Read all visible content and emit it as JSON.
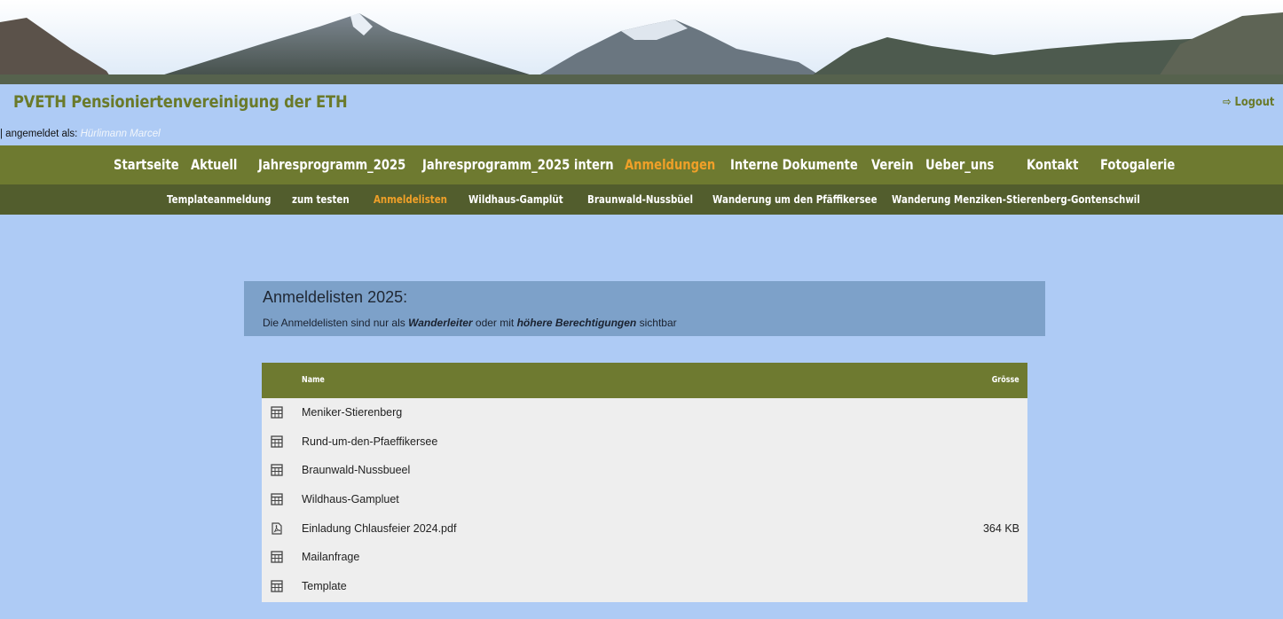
{
  "header": {
    "site_title": "PVETH Pensioniertenvereinigung der ETH",
    "logout_label": "Logout",
    "logged_in_label": "| angemeldet als:",
    "user_name": "Hürlimann Marcel"
  },
  "main_nav": {
    "items": [
      {
        "label": "Startseite",
        "active": false
      },
      {
        "label": "Aktuell",
        "active": false
      },
      {
        "label": "Jahresprogramm_2025",
        "active": false
      },
      {
        "label": "Jahresprogramm_2025 intern",
        "active": false
      },
      {
        "label": "Anmeldungen",
        "active": true
      },
      {
        "label": "Interne Dokumente",
        "active": false
      },
      {
        "label": "Verein",
        "active": false
      },
      {
        "label": "Ueber_uns",
        "active": false
      },
      {
        "label": "Kontakt",
        "active": false
      },
      {
        "label": "Fotogalerie",
        "active": false
      }
    ]
  },
  "sub_nav": {
    "items": [
      {
        "label": "Templateanmeldung",
        "active": false
      },
      {
        "label": "zum testen",
        "active": false
      },
      {
        "label": "Anmeldelisten",
        "active": true
      },
      {
        "label": "Wildhaus-Gamplüt",
        "active": false
      },
      {
        "label": "Braunwald-Nussbüel",
        "active": false
      },
      {
        "label": "Wanderung um den Pfäffikersee",
        "active": false
      },
      {
        "label": "Wanderung Menziken-Stierenberg-Gontenschwil",
        "active": false
      }
    ]
  },
  "content": {
    "heading": "Anmeldelisten  2025:",
    "desc_part1": "Die Anmeldelisten sind nur als ",
    "desc_bold1": "Wanderleiter",
    "desc_part2": " oder mit ",
    "desc_bold2": "höhere Berechtigungen",
    "desc_part3": " sichtbar"
  },
  "file_table": {
    "col_name": "Name",
    "col_size": "Grösse",
    "rows": [
      {
        "name": "Meniker-Stierenberg",
        "size": "",
        "icon": "spreadsheet-icon"
      },
      {
        "name": "Rund-um-den-Pfaeffikersee",
        "size": "",
        "icon": "spreadsheet-icon"
      },
      {
        "name": "Braunwald-Nussbueel",
        "size": "",
        "icon": "spreadsheet-icon"
      },
      {
        "name": "Wildhaus-Gampluet",
        "size": "",
        "icon": "spreadsheet-icon"
      },
      {
        "name": "Einladung Chlausfeier 2024.pdf",
        "size": "364 KB",
        "icon": "pdf-file-icon"
      },
      {
        "name": "Mailanfrage",
        "size": "",
        "icon": "spreadsheet-icon"
      },
      {
        "name": "Template",
        "size": "",
        "icon": "spreadsheet-icon"
      }
    ]
  },
  "colors": {
    "page_bg": "#aecbf5",
    "nav_bg": "#6e7a30",
    "subnav_bg": "#525d2d",
    "accent_active": "#f0a028",
    "title_green": "#6a7a2a"
  }
}
